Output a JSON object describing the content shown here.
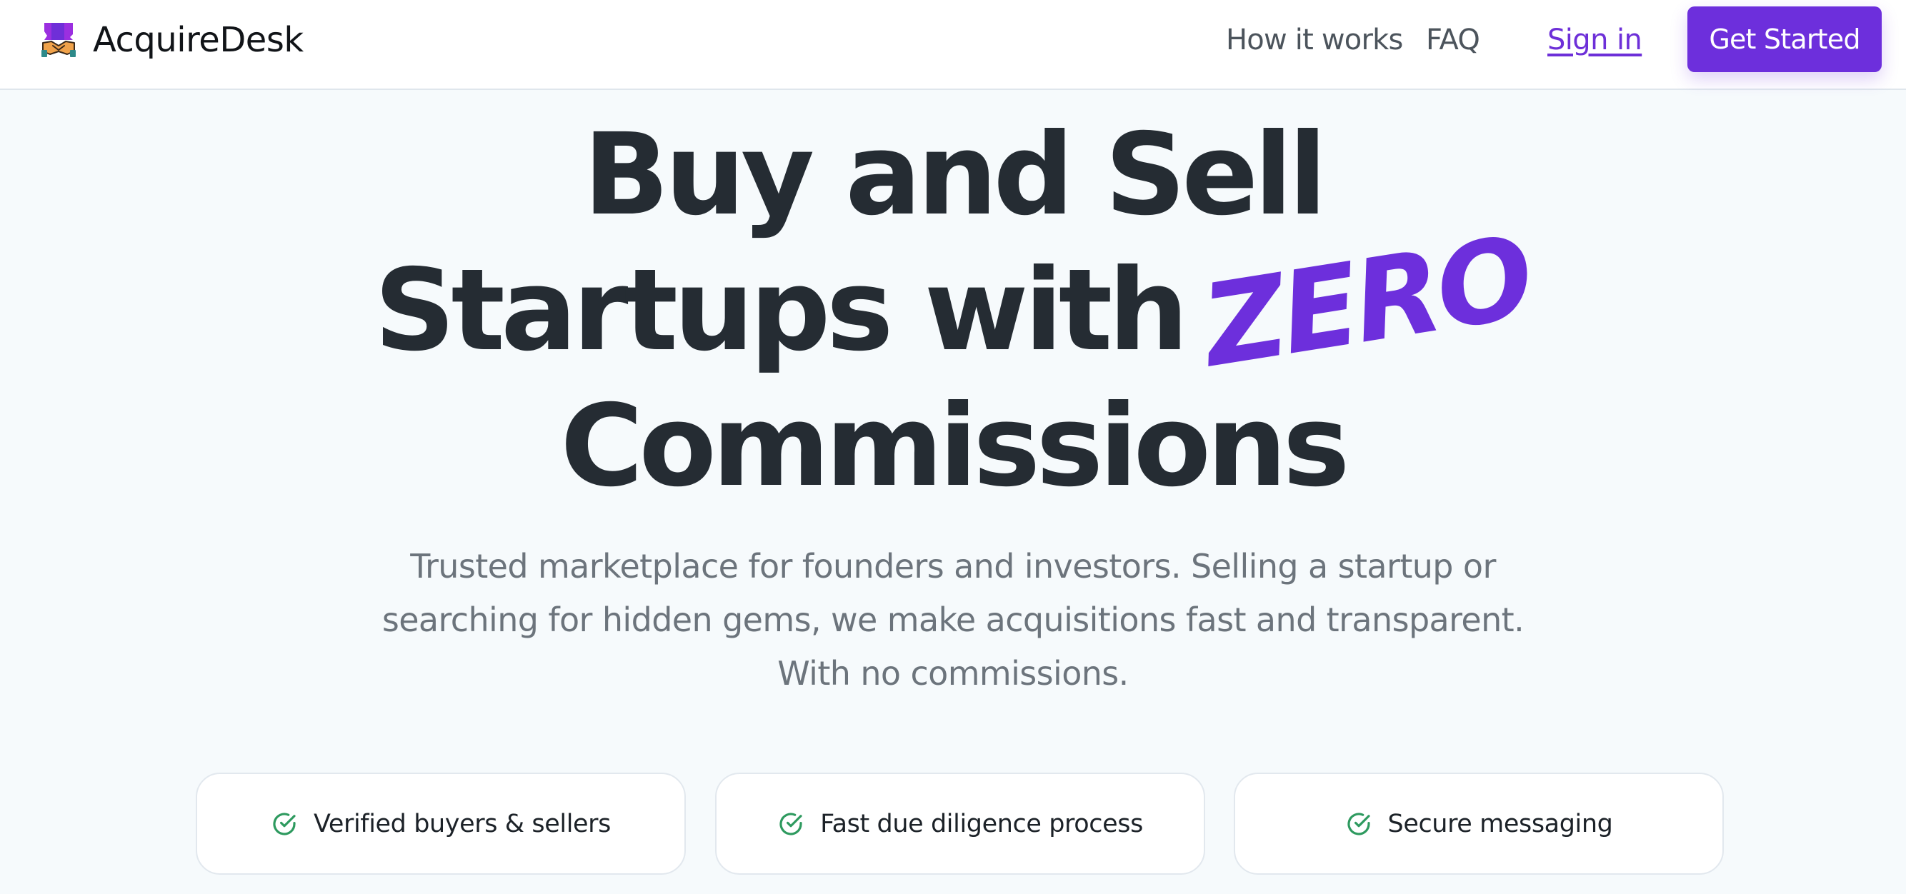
{
  "header": {
    "brand_name": "AcquireDesk",
    "brand_icon": "handshake-logo-icon",
    "nav": {
      "how_it_works": "How it works",
      "faq": "FAQ",
      "sign_in": "Sign in",
      "get_started": "Get Started"
    }
  },
  "hero": {
    "title_line_1": "Buy and Sell",
    "title_line_2": "Startups with",
    "title_highlight": "ZERO",
    "title_line_3": "Commissions",
    "subtitle_line_1": "Trusted marketplace for founders and investors. Selling a startup or",
    "subtitle_line_2": "searching for hidden gems, we make acquisitions fast and transparent.",
    "subtitle_line_3": "With no commissions."
  },
  "features": [
    {
      "label": "Verified buyers & sellers",
      "icon": "check-circle-icon"
    },
    {
      "label": "Fast due diligence process",
      "icon": "check-circle-icon"
    },
    {
      "label": "Secure messaging",
      "icon": "check-circle-icon"
    }
  ],
  "colors": {
    "accent": "#6d2fdc",
    "text_dark": "#252c33",
    "text_muted": "#6c747c",
    "page_bg": "#f6fafc",
    "check_green": "#2e9a5f"
  }
}
